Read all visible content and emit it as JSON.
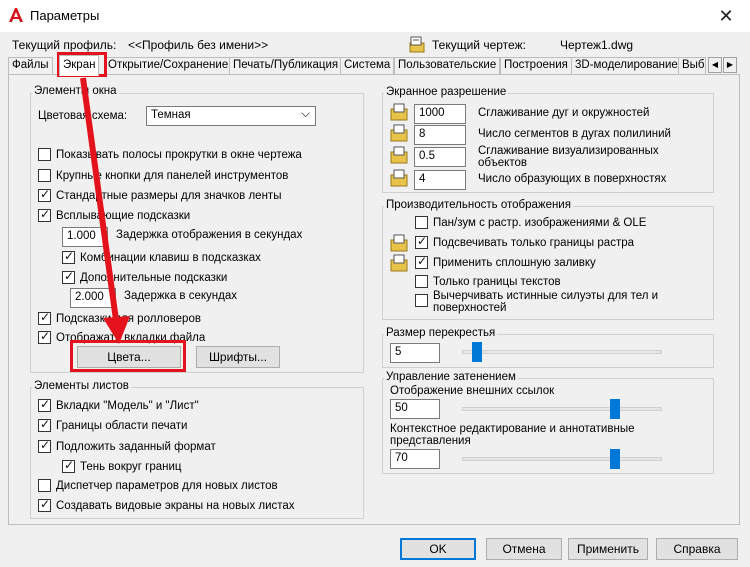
{
  "window": {
    "title": "Параметры",
    "close_glyph": "✕",
    "icon": "autocad-logo-icon"
  },
  "profile": {
    "label": "Текущий профиль:",
    "value": "<<Профиль без имени>>",
    "drawing_label": "Текущий чертеж:",
    "drawing_value": "Чертеж1.dwg"
  },
  "tabs": [
    {
      "label": "Файлы"
    },
    {
      "label": "Экран",
      "active": true
    },
    {
      "label": "Открытие/Сохранение"
    },
    {
      "label": "Печать/Публикация"
    },
    {
      "label": "Система"
    },
    {
      "label": "Пользовательские"
    },
    {
      "label": "Построения"
    },
    {
      "label": "3D-моделирование"
    },
    {
      "label": "Выб"
    }
  ],
  "tab_scroll": {
    "left": "◀",
    "right": "▶"
  },
  "window_elements": {
    "title": "Элементы окна",
    "color_scheme_label": "Цветовая схема:",
    "color_scheme_value": "Темная",
    "dropdown_glyph": "⌵",
    "options": [
      {
        "label": "Показывать полосы прокрутки в окне чертежа",
        "checked": false
      },
      {
        "label": "Крупные кнопки для панелей инструментов",
        "checked": false
      },
      {
        "label": "Стандартные размеры для значков ленты",
        "checked": true
      },
      {
        "label": "Всплывающие подсказки",
        "checked": true
      }
    ],
    "tooltip_delay_value": "1.000",
    "tooltip_delay_label": "Задержка отображения в секундах",
    "shortcut_keys_label": "Комбинации клавиш в подсказках",
    "shortcut_keys_checked": true,
    "extended_tooltips_label": "Дополнительные подсказки",
    "extended_tooltips_checked": true,
    "extended_delay_value": "2.000",
    "extended_delay_label": "Задержка в секундах",
    "rollover_label": "Подсказки для ролловеров",
    "rollover_checked": true,
    "file_tabs_label": "Отображать вкладки файла",
    "file_tabs_checked": true,
    "colors_button": "Цвета...",
    "fonts_button": "Шрифты..."
  },
  "layout_elements": {
    "title": "Элементы листов",
    "options": [
      {
        "label": "Вкладки \"Модель\" и \"Лист\"",
        "checked": true
      },
      {
        "label": "Границы области печати",
        "checked": true
      },
      {
        "label": "Подложить заданный формат",
        "checked": true
      },
      {
        "label": "Тень вокруг границ",
        "checked": true
      },
      {
        "label": "Диспетчер параметров для новых листов",
        "checked": false
      },
      {
        "label": "Создавать видовые экраны на новых листах",
        "checked": true
      }
    ]
  },
  "display_resolution": {
    "title": "Экранное разрешение",
    "rows": [
      {
        "value": "1000",
        "label": "Сглаживание дуг и окружностей"
      },
      {
        "value": "8",
        "label": "Число сегментов в дугах полилиний"
      },
      {
        "value": "0.5",
        "label": "Сглаживание визуализированных объектов"
      },
      {
        "value": "4",
        "label": "Число образующих в поверхностях"
      }
    ]
  },
  "display_performance": {
    "title": "Производительность отображения",
    "options": [
      {
        "label": "Пан/зум с растр. изображениями & OLE",
        "checked": false
      },
      {
        "label": "Подсвечивать только границы растра",
        "checked": true
      },
      {
        "label": "Применить сплошную заливку",
        "checked": true
      },
      {
        "label": "Только границы текстов",
        "checked": false
      },
      {
        "label": "Вычерчивать истинные силуэты для тел и поверхностей",
        "checked": false
      }
    ]
  },
  "crosshair": {
    "title": "Размер перекрестья",
    "value": "5",
    "fraction": 0.05
  },
  "fade_control": {
    "title": "Управление затенением",
    "xref_label": "Отображение внешних ссылок",
    "xref_value": "50",
    "xref_fraction": 0.78,
    "inplace_label": "Контекстное редактирование и аннотативные представления",
    "inplace_value": "70",
    "inplace_fraction": 0.78
  },
  "footer": {
    "ok": "OK",
    "cancel": "Отмена",
    "apply": "Применить",
    "help": "Справка"
  },
  "colors": {
    "accent": "#0078d7",
    "annotation_red": "#e3121c"
  }
}
